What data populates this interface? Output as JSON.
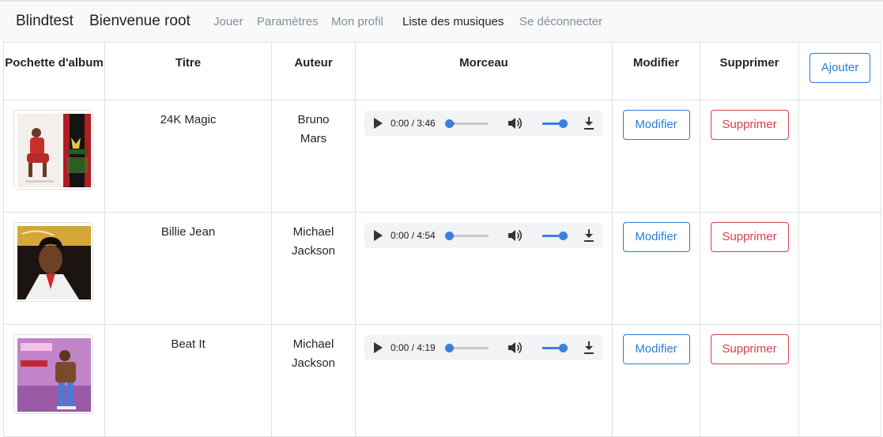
{
  "app": {
    "brand": "Blindtest",
    "welcome": "Bienvenue root"
  },
  "nav": [
    {
      "label": "Jouer",
      "active": false
    },
    {
      "label": "Paramètres",
      "active": false
    },
    {
      "label": "Mon profil",
      "active": false
    },
    {
      "label": "Liste des musiques",
      "active": true
    },
    {
      "label": "Se déconnecter",
      "active": false
    }
  ],
  "table": {
    "headers": {
      "cover": "Pochette d'album",
      "title": "Titre",
      "author": "Auteur",
      "track": "Morceau",
      "edit": "Modifier",
      "delete": "Supprimer"
    },
    "add_label": "Ajouter",
    "rows": [
      {
        "title": "24K Magic",
        "author": "Bruno Mars",
        "time": "0:00 / 3:46",
        "edit_label": "Modifier",
        "delete_label": "Supprimer"
      },
      {
        "title": "Billie Jean",
        "author": "Michael Jackson",
        "time": "0:00 / 4:54",
        "edit_label": "Modifier",
        "delete_label": "Supprimer"
      },
      {
        "title": "Beat It",
        "author": "Michael Jackson",
        "time": "0:00 / 4:19",
        "edit_label": "Modifier",
        "delete_label": "Supprimer"
      }
    ]
  },
  "colors": {
    "primary": "#2a7bd8",
    "danger": "#d43f4b",
    "player_accent": "#3b7fe0"
  }
}
